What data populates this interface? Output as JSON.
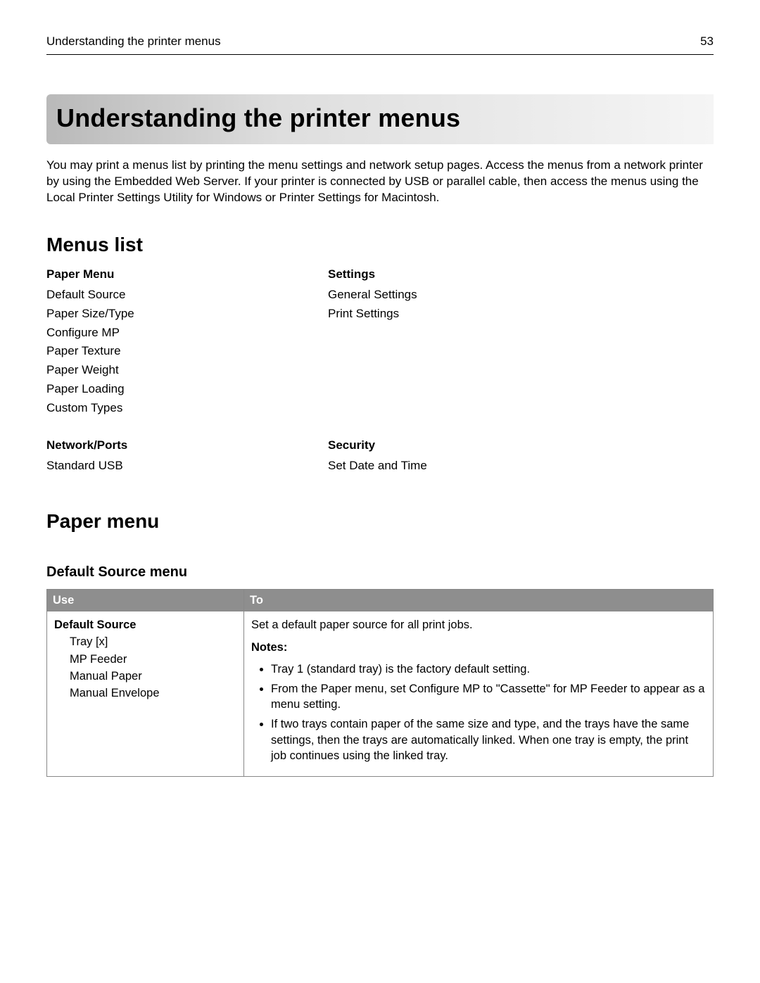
{
  "header": {
    "title": "Understanding the printer menus",
    "page": "53"
  },
  "h1": "Understanding the printer menus",
  "intro": "You may print a menus list by printing the menu settings and network setup pages. Access the menus from a network printer by using the Embedded Web Server. If your printer is connected by USB or parallel cable, then access the menus using the Local Printer Settings Utility for Windows or Printer Settings for Macintosh.",
  "menus_list": {
    "heading": "Menus list",
    "row1": {
      "left_head": "Paper Menu",
      "left_items": [
        "Default Source",
        "Paper Size/Type",
        "Configure MP",
        "Paper Texture",
        "Paper Weight",
        "Paper Loading",
        "Custom Types"
      ],
      "right_head": "Settings",
      "right_items": [
        "General Settings",
        "Print Settings"
      ]
    },
    "row2": {
      "left_head": "Network/Ports",
      "left_items": [
        "Standard USB"
      ],
      "right_head": "Security",
      "right_items": [
        "Set Date and Time"
      ]
    }
  },
  "paper_menu": {
    "heading": "Paper menu",
    "default_source": {
      "heading": "Default Source menu",
      "th_use": "Use",
      "th_to": "To",
      "opt_title": "Default Source",
      "options": [
        "Tray [x]",
        "MP Feeder",
        "Manual Paper",
        "Manual Envelope"
      ],
      "desc": "Set a default paper source for all print jobs.",
      "notes_label": "Notes:",
      "notes": [
        "Tray 1 (standard tray) is the factory default setting.",
        "From the Paper menu, set Configure MP to \"Cassette\" for MP Feeder to appear as a menu setting.",
        "If two trays contain paper of the same size and type, and the trays have the same settings, then the trays are automatically linked. When one tray is empty, the print job continues using the linked tray."
      ]
    }
  }
}
